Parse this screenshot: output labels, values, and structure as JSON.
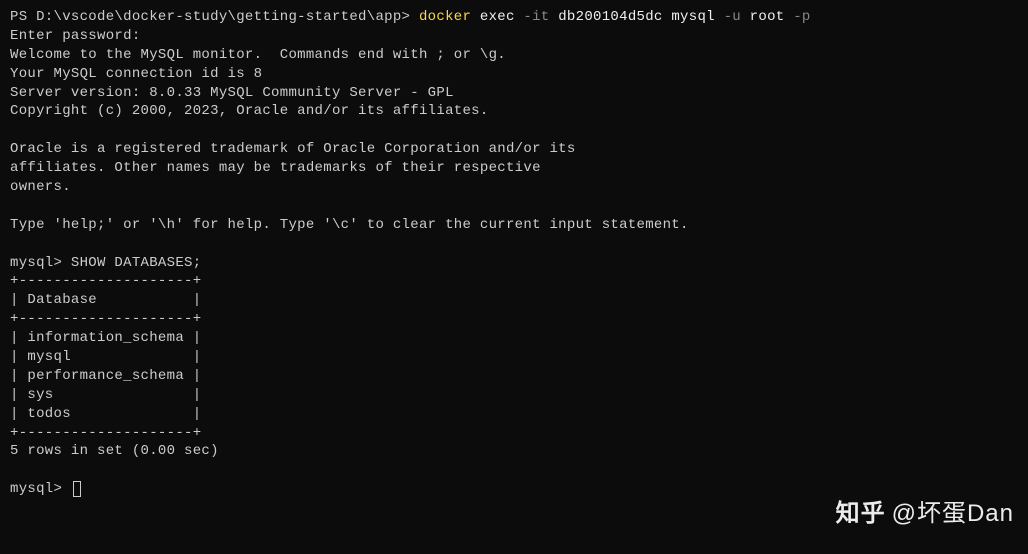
{
  "prompt": {
    "ps_prefix": "PS D:\\vscode\\docker-study\\getting-started\\app> ",
    "docker_cmd": "docker",
    "exec": " exec ",
    "flags1": "-it",
    "container_id": " db200104d5dc ",
    "mysql": "mysql ",
    "flag_u": "-u",
    "root": " root ",
    "flag_p": "-p"
  },
  "lines": {
    "enter_password": "Enter password:",
    "welcome": "Welcome to the MySQL monitor.  Commands end with ; or \\g.",
    "connection_id": "Your MySQL connection id is 8",
    "server_version": "Server version: 8.0.33 MySQL Community Server - GPL",
    "blank": "",
    "copyright": "Copyright (c) 2000, 2023, Oracle and/or its affiliates.",
    "trademark1": "Oracle is a registered trademark of Oracle Corporation and/or its",
    "trademark2": "affiliates. Other names may be trademarks of their respective",
    "trademark3": "owners.",
    "help": "Type 'help;' or '\\h' for help. Type '\\c' to clear the current input statement.",
    "mysql_show": "mysql> SHOW DATABASES;",
    "tbl_border": "+--------------------+",
    "tbl_header": "| Database           |",
    "tbl_row1": "| information_schema |",
    "tbl_row2": "| mysql              |",
    "tbl_row3": "| performance_schema |",
    "tbl_row4": "| sys                |",
    "tbl_row5": "| todos              |",
    "rows_result": "5 rows in set (0.00 sec)",
    "mysql_prompt": "mysql> "
  },
  "databases": [
    "information_schema",
    "mysql",
    "performance_schema",
    "sys",
    "todos"
  ],
  "watermark": {
    "site": "知乎",
    "handle": "@坏蛋Dan"
  }
}
